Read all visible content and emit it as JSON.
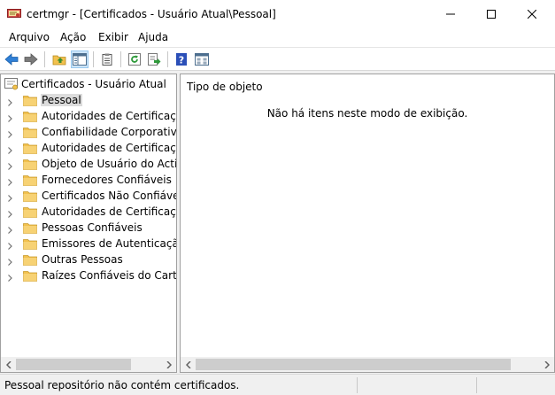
{
  "window": {
    "title": "certmgr - [Certificados - Usuário Atual\\Pessoal]",
    "controls": {
      "minimize": "—",
      "maximize": "☐",
      "close": "✕"
    }
  },
  "menu": [
    {
      "label": "Arquivo"
    },
    {
      "label": "Ação"
    },
    {
      "label": "Exibir"
    },
    {
      "label": "Ajuda"
    }
  ],
  "toolbar": [
    {
      "icon": "back-arrow-icon"
    },
    {
      "icon": "forward-arrow-icon"
    },
    {
      "icon": "up-folder-icon"
    },
    {
      "icon": "show-hide-tree-icon",
      "active": true
    },
    {
      "icon": "properties-icon"
    },
    {
      "icon": "refresh-icon"
    },
    {
      "icon": "export-list-icon"
    },
    {
      "icon": "help-icon"
    },
    {
      "icon": "view-icon"
    }
  ],
  "tree": {
    "root": "Certificados - Usuário Atual",
    "items": [
      {
        "label": "Pessoal",
        "selected": true
      },
      {
        "label": "Autoridades de Certificação R"
      },
      {
        "label": "Confiabilidade Corporativa"
      },
      {
        "label": "Autoridades de Certificação I"
      },
      {
        "label": "Objeto de Usuário do Active D"
      },
      {
        "label": "Fornecedores Confiáveis"
      },
      {
        "label": "Certificados Não Confiáveis"
      },
      {
        "label": "Autoridades de Certificação R"
      },
      {
        "label": "Pessoas Confiáveis"
      },
      {
        "label": "Emissores de Autenticação de"
      },
      {
        "label": "Outras Pessoas"
      },
      {
        "label": "Raízes Confiáveis do Cartão In"
      }
    ]
  },
  "list": {
    "column_header": "Tipo de objeto",
    "empty_message": "Não há itens neste modo de exibição."
  },
  "status": {
    "text": "Pessoal repositório não contém certificados."
  },
  "colors": {
    "folder": "#f2c14e",
    "selection": "#dcdcdc",
    "toolbar_active": "#cce4f7",
    "back_arrow": "#2f7fd6",
    "help": "#2b4fb8"
  }
}
